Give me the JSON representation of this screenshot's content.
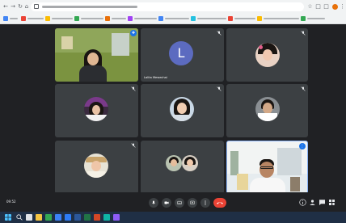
{
  "browser": {
    "url": "",
    "bookmarks": [
      {
        "label": "",
        "color": "#4285f4"
      },
      {
        "label": "",
        "color": "#ea4335"
      },
      {
        "label": "",
        "color": "#fbbc04"
      },
      {
        "label": "",
        "color": "#34a853"
      },
      {
        "label": "",
        "color": "#e8710a"
      },
      {
        "label": "",
        "color": "#a142f4"
      },
      {
        "label": "",
        "color": "#4285f4"
      },
      {
        "label": "",
        "color": "#24c1e0"
      },
      {
        "label": "",
        "color": "#ea4335"
      },
      {
        "label": "",
        "color": "#fbbc04"
      },
      {
        "label": "",
        "color": "#34a853"
      }
    ]
  },
  "meet": {
    "time": "09:52",
    "meeting_code": "",
    "participants": [
      {
        "name": "",
        "tile_color": "#6f8a3a",
        "kind": "photo",
        "muted": false,
        "pinned": true
      },
      {
        "name": "Lalita Mewechai",
        "tile_color": "#3c4043",
        "kind": "letter",
        "letter": "L",
        "avatar_color": "#5c6bc0",
        "muted": true
      },
      {
        "name": "",
        "tile_color": "#3c4043",
        "kind": "avatar-photo",
        "muted": true
      },
      {
        "name": "",
        "tile_color": "#3c4043",
        "kind": "avatar-photo",
        "muted": true
      },
      {
        "name": "",
        "tile_color": "#3c4043",
        "kind": "avatar-photo",
        "muted": true
      },
      {
        "name": "",
        "tile_color": "#3c4043",
        "kind": "avatar-photo",
        "muted": true
      },
      {
        "name": "",
        "tile_color": "#3c4043",
        "kind": "avatar-photo",
        "muted": true
      },
      {
        "name": "",
        "tile_color": "#3c4043",
        "kind": "group",
        "muted": false
      },
      {
        "name": "",
        "tile_color": "#dfe6ea",
        "kind": "video",
        "muted": false,
        "pinned": true
      }
    ],
    "status_colors": {
      "end_call": "#ea4335",
      "accent": "#1a73e8"
    }
  },
  "icons": [
    "back-icon",
    "forward-icon",
    "reload-icon",
    "home-icon",
    "lock-icon",
    "star-icon",
    "extension-icon",
    "mic-icon",
    "camera-icon",
    "captions-icon",
    "present-icon",
    "more-icon",
    "end-call-icon",
    "info-icon",
    "people-icon",
    "chat-icon",
    "activities-icon",
    "mic-off-icon",
    "pin-icon"
  ],
  "taskbar": {
    "weather": "",
    "language": "",
    "clock_time": "",
    "clock_date": ""
  }
}
